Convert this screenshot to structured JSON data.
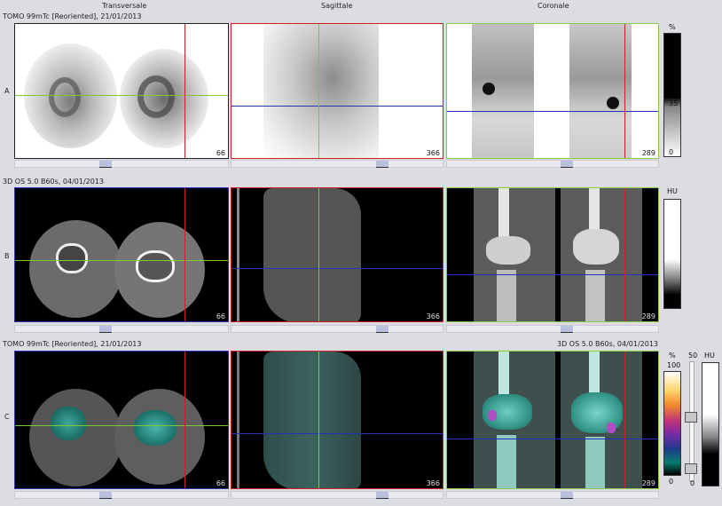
{
  "headers": {
    "transversale": "Transversale",
    "sagittale": "Sagittale",
    "coronale": "Coronale"
  },
  "rows": {
    "a": {
      "letter": "A",
      "title": "TOMO 99mTc [Reoriented], 21/01/2013",
      "slices": {
        "transversal": "66",
        "sagittal": "366",
        "coronal": "289"
      }
    },
    "b": {
      "letter": "B",
      "title": "3D  OS  5.0  B60s, 04/01/2013",
      "slices": {
        "transversal": "66",
        "sagittal": "366",
        "coronal": "289"
      }
    },
    "c": {
      "letter": "C",
      "title": "TOMO 99mTc [Reoriented], 21/01/2013",
      "title_right": "3D  OS  5.0  B60s, 04/01/2013",
      "slices": {
        "transversal": "66",
        "sagittal": "366",
        "coronal": "289"
      }
    }
  },
  "scales": {
    "a": {
      "unit": "%",
      "mid": "35",
      "low": "0"
    },
    "b": {
      "unit": "HU"
    },
    "c": {
      "unit_left": "%",
      "top": "100",
      "low": "0",
      "unit_mid": "50",
      "unit_right": "HU",
      "low_mid": "0"
    }
  },
  "colors": {
    "transversal_frame": "#111111",
    "sagittal_frame": "#cc2222",
    "coronal_frame": "#88cc44",
    "ct_frame": "#3333aa",
    "crosshair_red": "#cc2222",
    "crosshair_green": "#77cc33",
    "crosshair_blue": "#2233bb"
  }
}
